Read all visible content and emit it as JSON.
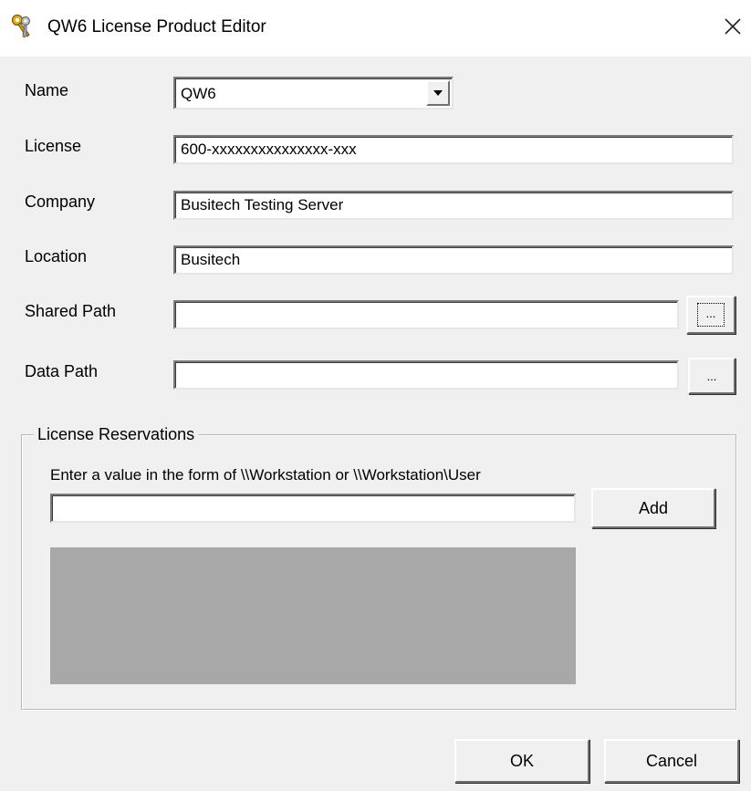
{
  "window": {
    "title": "QW6 License Product Editor"
  },
  "form": {
    "name_label": "Name",
    "name_value": "QW6",
    "license_label": "License",
    "license_value": "600-xxxxxxxxxxxxxxx-xxx",
    "company_label": "Company",
    "company_value": "Busitech Testing Server",
    "location_label": "Location",
    "location_value": "Busitech",
    "shared_path_label": "Shared Path",
    "shared_path_value": "",
    "shared_browse_label": "...",
    "data_path_label": "Data Path",
    "data_path_value": "",
    "data_browse_label": "..."
  },
  "reservations": {
    "group_label": "License Reservations",
    "instruction": "Enter a value in the form of \\\\Workstation or \\\\Workstation\\User",
    "entry_value": "",
    "add_label": "Add",
    "items": []
  },
  "footer": {
    "ok_label": "OK",
    "cancel_label": "Cancel"
  },
  "icons": {
    "title": "keys-icon",
    "close": "close-icon",
    "combo": "dropdown-arrow-icon"
  }
}
